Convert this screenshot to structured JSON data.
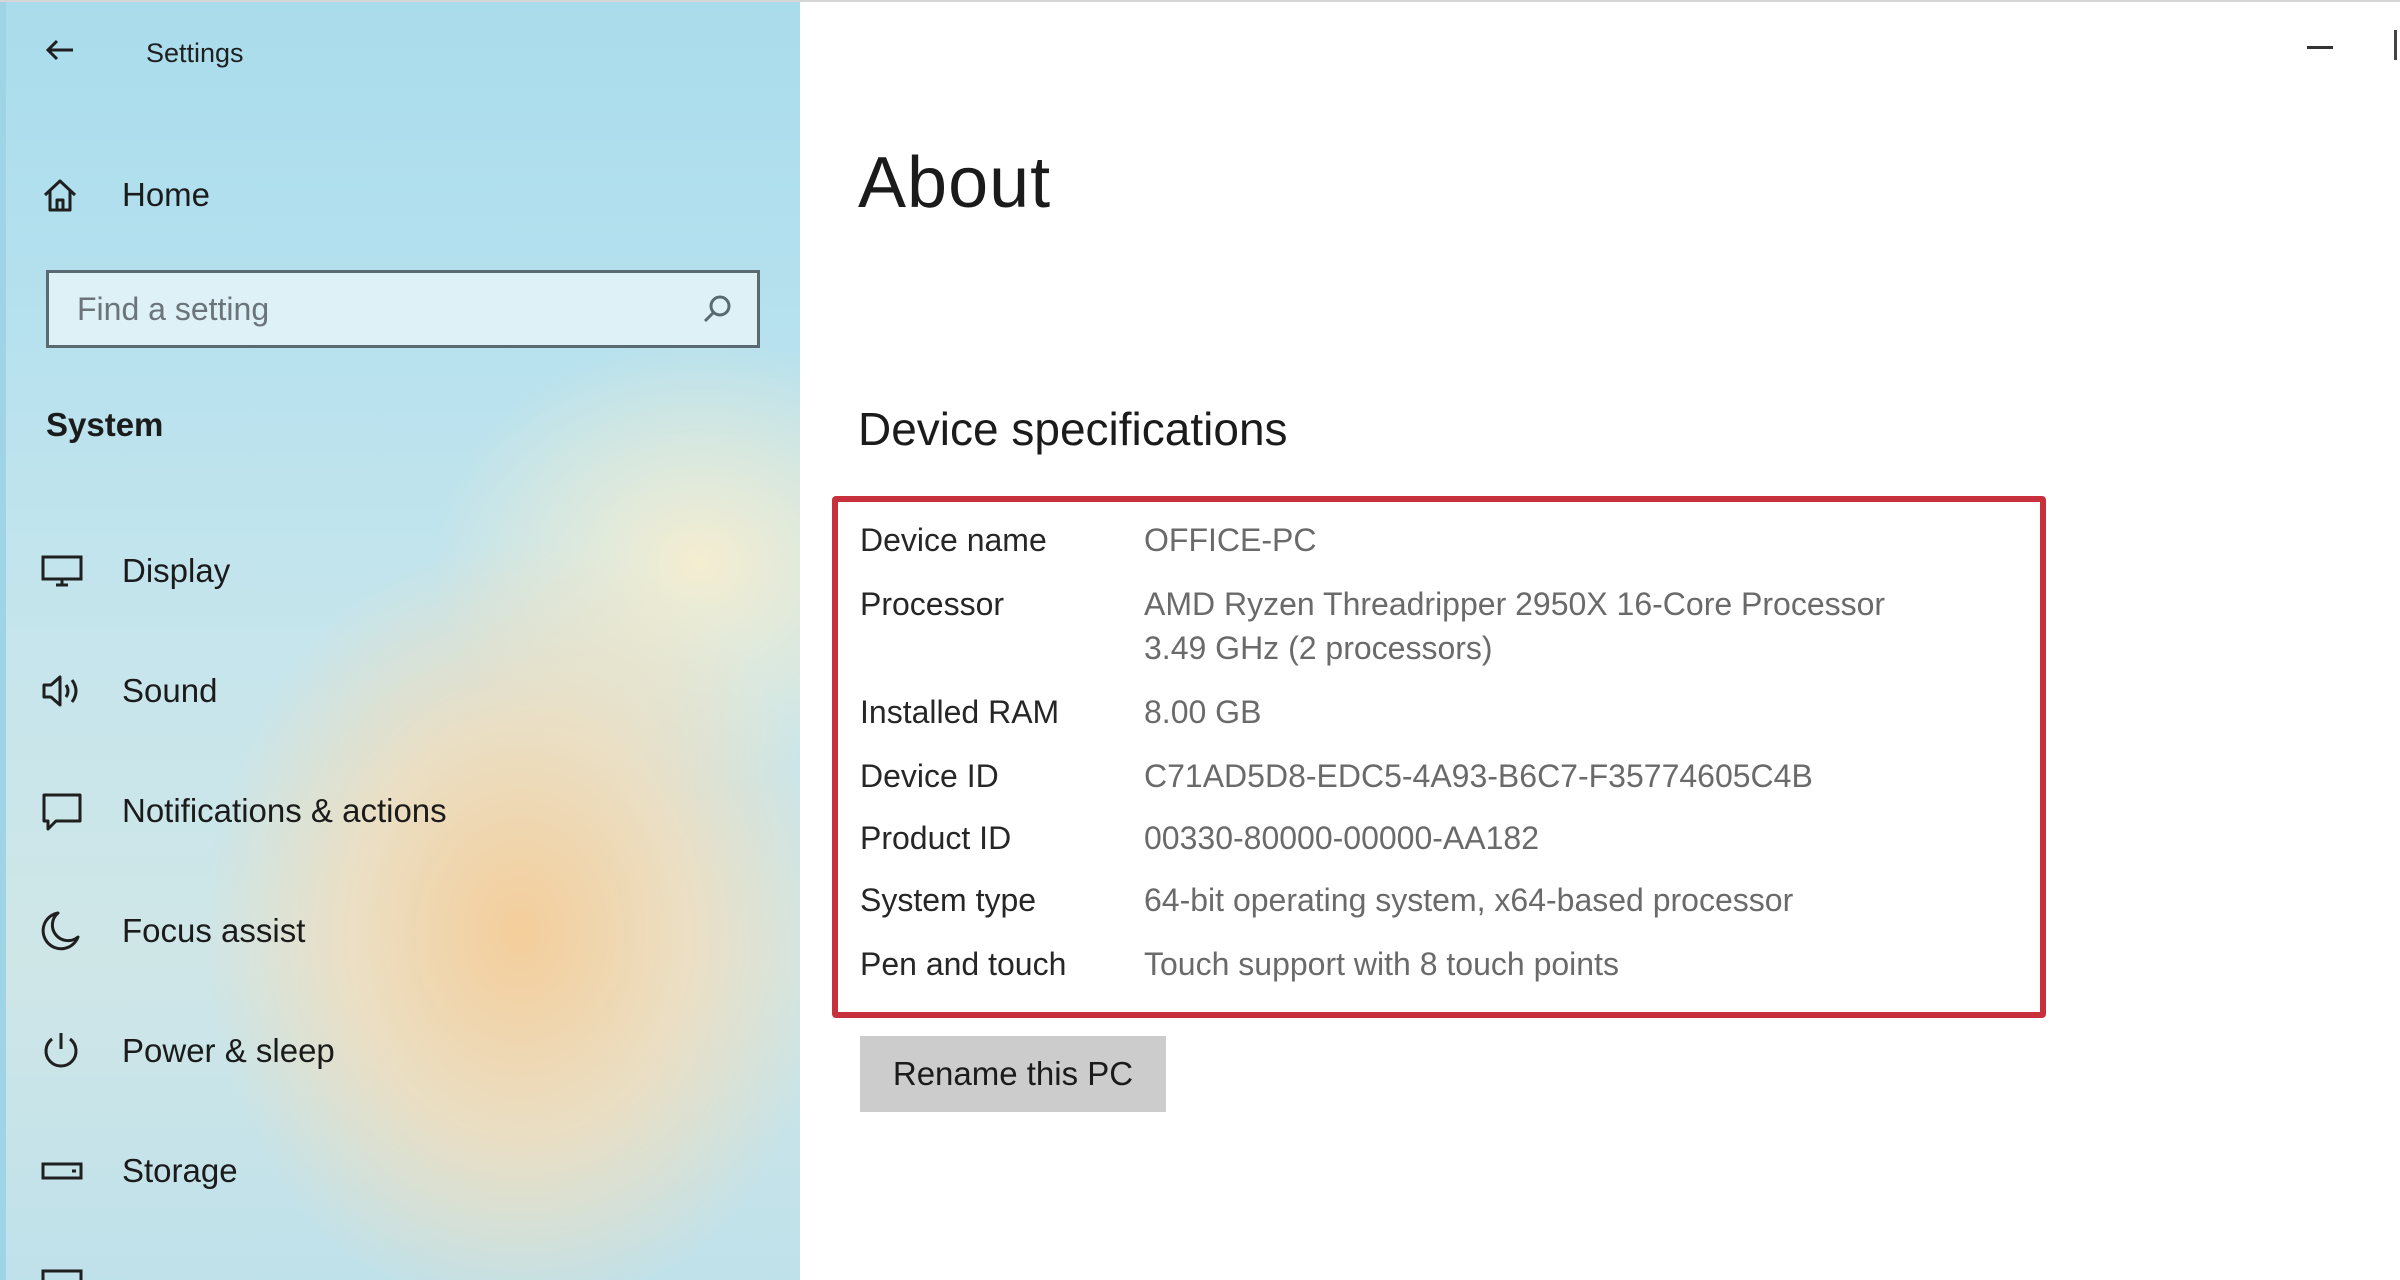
{
  "window": {
    "title": "Settings"
  },
  "sidebar": {
    "home_label": "Home",
    "search": {
      "placeholder": "Find a setting"
    },
    "section_heading": "System",
    "items": [
      {
        "label": "Display",
        "icon": "display-icon"
      },
      {
        "label": "Sound",
        "icon": "sound-icon"
      },
      {
        "label": "Notifications & actions",
        "icon": "notifications-icon"
      },
      {
        "label": "Focus assist",
        "icon": "focus-assist-icon"
      },
      {
        "label": "Power & sleep",
        "icon": "power-icon"
      },
      {
        "label": "Storage",
        "icon": "storage-icon"
      }
    ]
  },
  "main": {
    "title": "About",
    "specs_heading": "Device specifications",
    "specs": [
      {
        "label": "Device name",
        "value": "OFFICE-PC"
      },
      {
        "label": "Processor",
        "value": "AMD Ryzen Threadripper 2950X 16-Core Processor",
        "value2": "3.49 GHz  (2 processors)"
      },
      {
        "label": "Installed RAM",
        "value": "8.00 GB"
      },
      {
        "label": "Device ID",
        "value": "C71AD5D8-EDC5-4A93-B6C7-F35774605C4B"
      },
      {
        "label": "Product ID",
        "value": "00330-80000-00000-AA182"
      },
      {
        "label": "System type",
        "value": "64-bit operating system, x64-based processor"
      },
      {
        "label": "Pen and touch",
        "value": "Touch support with 8 touch points"
      }
    ],
    "rename_button": "Rename this PC"
  },
  "colors": {
    "highlight_border": "#c8313c",
    "button_bg": "#cccccc"
  }
}
